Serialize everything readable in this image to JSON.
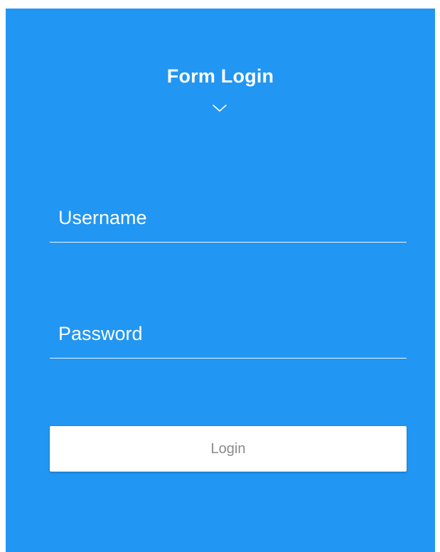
{
  "form": {
    "title": "Form Login",
    "toggle_icon": "chevron-down-icon",
    "username_placeholder": "Username",
    "password_placeholder": "Password",
    "login_label": "Login"
  },
  "colors": {
    "panel_background": "#2196f3",
    "text": "#ffffff",
    "button_background": "#ffffff",
    "button_text": "#8a8a8a"
  }
}
